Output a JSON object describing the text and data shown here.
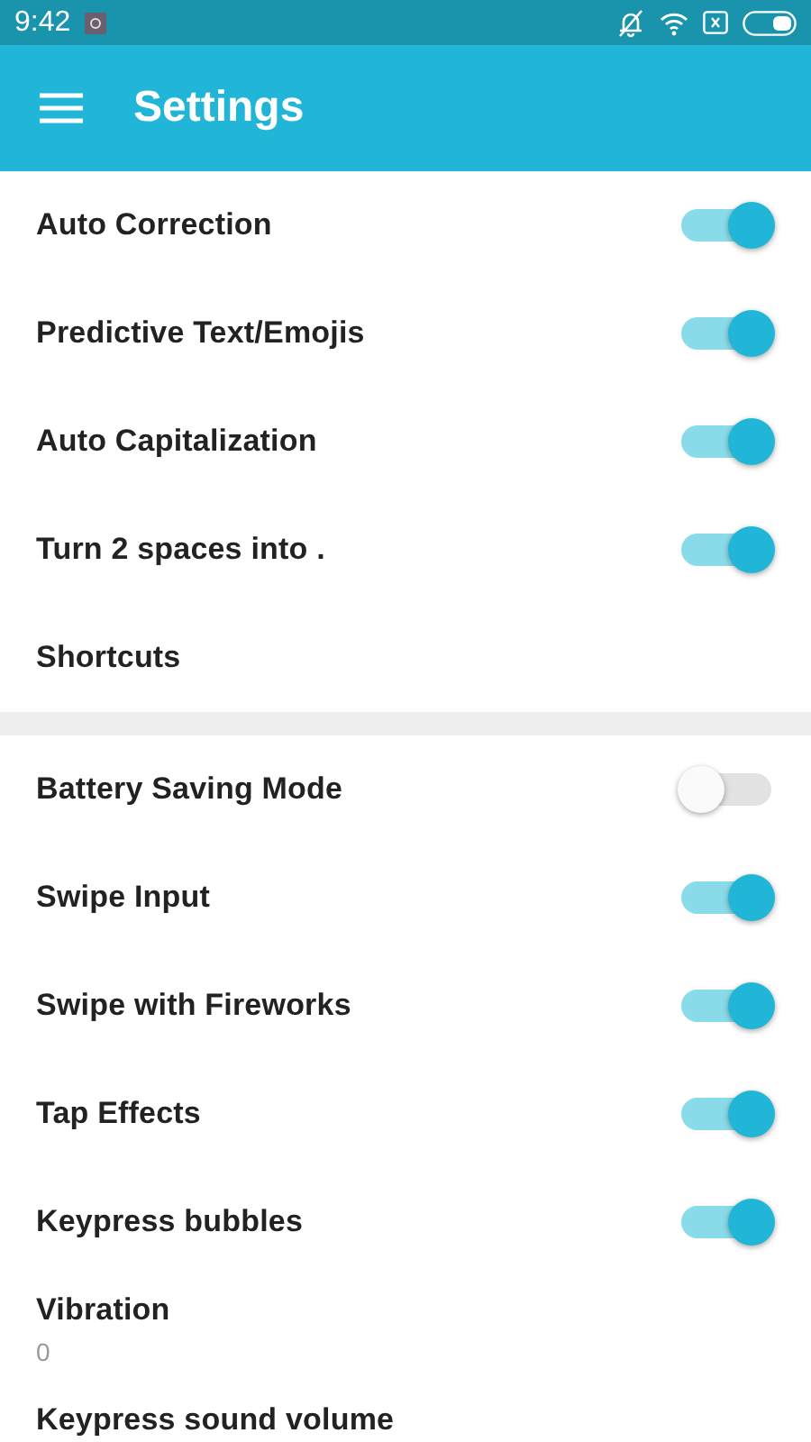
{
  "status_bar": {
    "time": "9:42"
  },
  "app_bar": {
    "title": "Settings"
  },
  "sections": [
    {
      "items": [
        {
          "kind": "toggle",
          "label": "Auto Correction",
          "on": true
        },
        {
          "kind": "toggle",
          "label": "Predictive Text/Emojis",
          "on": true
        },
        {
          "kind": "toggle",
          "label": "Auto Capitalization",
          "on": true
        },
        {
          "kind": "toggle",
          "label": "Turn 2 spaces into .",
          "on": true
        },
        {
          "kind": "plain",
          "label": "Shortcuts"
        }
      ]
    },
    {
      "items": [
        {
          "kind": "toggle",
          "label": "Battery Saving Mode",
          "on": false
        },
        {
          "kind": "toggle",
          "label": "Swipe Input",
          "on": true
        },
        {
          "kind": "toggle",
          "label": "Swipe with Fireworks",
          "on": true
        },
        {
          "kind": "toggle",
          "label": "Tap Effects",
          "on": true
        },
        {
          "kind": "toggle",
          "label": "Keypress bubbles",
          "on": true
        },
        {
          "kind": "summary",
          "label": "Vibration",
          "summary": "0"
        },
        {
          "kind": "plain",
          "label": "Keypress sound volume"
        }
      ]
    }
  ]
}
